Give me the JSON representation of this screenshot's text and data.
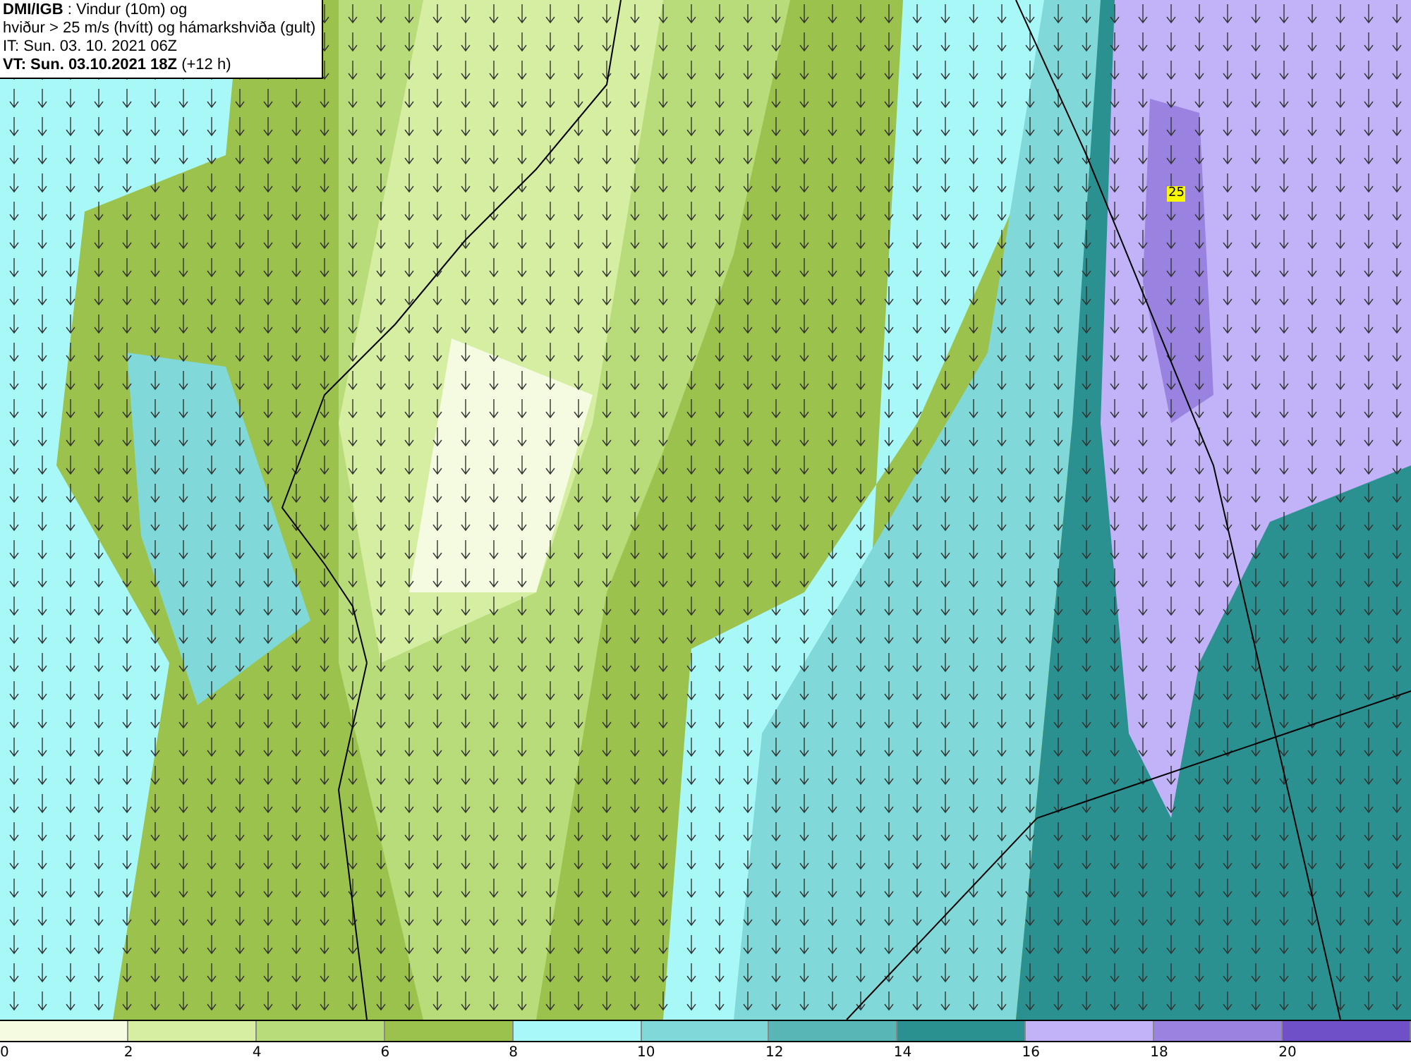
{
  "title_box": {
    "lines": [
      "**DMI/IGB** : Vindur (10m) og",
      "hviður > 25 m/s (hvítt) og hámarkshviða (gult)",
      "IT: Sun. 03. 10. 2021 06Z",
      "**VT: Sun. 03.10.2021 18Z** (+12 h)"
    ]
  },
  "map": {
    "gust_labels": [
      {
        "text": "25"
      }
    ]
  },
  "legend": {
    "bins": [
      {
        "color": "#f4fbe0",
        "label": "0"
      },
      {
        "color": "#d6eea2",
        "label": "2"
      },
      {
        "color": "#b9dc7a",
        "label": "4"
      },
      {
        "color": "#9bc24c",
        "label": "6"
      },
      {
        "color": "#a9f8f8",
        "label": "8"
      },
      {
        "color": "#80d8d8",
        "label": "10"
      },
      {
        "color": "#58b6b6",
        "label": "12"
      },
      {
        "color": "#2a9090",
        "label": "14"
      },
      {
        "color": "#c2b2f8",
        "label": "16"
      },
      {
        "color": "#9a82e0",
        "label": "18"
      },
      {
        "color": "#7050c8",
        "label": "20"
      }
    ]
  }
}
